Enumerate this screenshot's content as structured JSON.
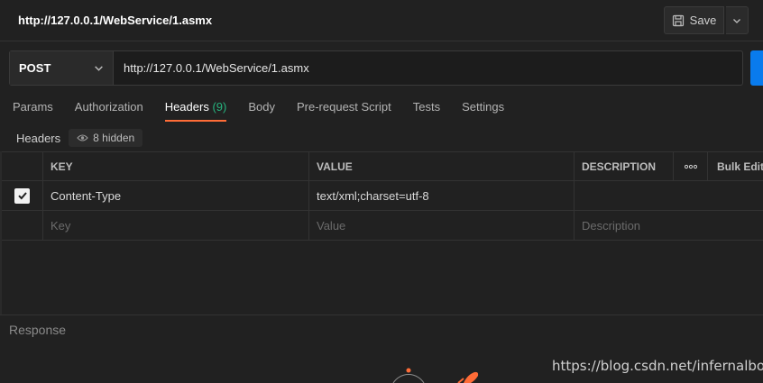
{
  "header": {
    "request_title": "http://127.0.0.1/WebService/1.asmx",
    "save_label": "Save"
  },
  "request": {
    "method": "POST",
    "url": "http://127.0.0.1/WebService/1.asmx"
  },
  "tabs": [
    {
      "label": "Params"
    },
    {
      "label": "Authorization"
    },
    {
      "label": "Headers",
      "count": "(9)",
      "active": true
    },
    {
      "label": "Body"
    },
    {
      "label": "Pre-request Script"
    },
    {
      "label": "Tests"
    },
    {
      "label": "Settings"
    }
  ],
  "headers_section": {
    "label": "Headers",
    "hidden_label": "8 hidden"
  },
  "table": {
    "columns": {
      "key": "KEY",
      "value": "VALUE",
      "description": "DESCRIPTION",
      "more": "ooo",
      "bulk_edit": "Bulk Edit"
    },
    "rows": [
      {
        "checked": true,
        "key": "Content-Type",
        "value": "text/xml;charset=utf-8",
        "description": ""
      }
    ],
    "placeholders": {
      "key": "Key",
      "value": "Value",
      "description": "Description"
    }
  },
  "response": {
    "label": "Response"
  },
  "watermark": "https://blog.csdn.net/infernalboy",
  "colors": {
    "background": "#212121",
    "accent_tab": "#ff6c37",
    "count_green": "#26b47f",
    "send_blue": "#097bed"
  }
}
